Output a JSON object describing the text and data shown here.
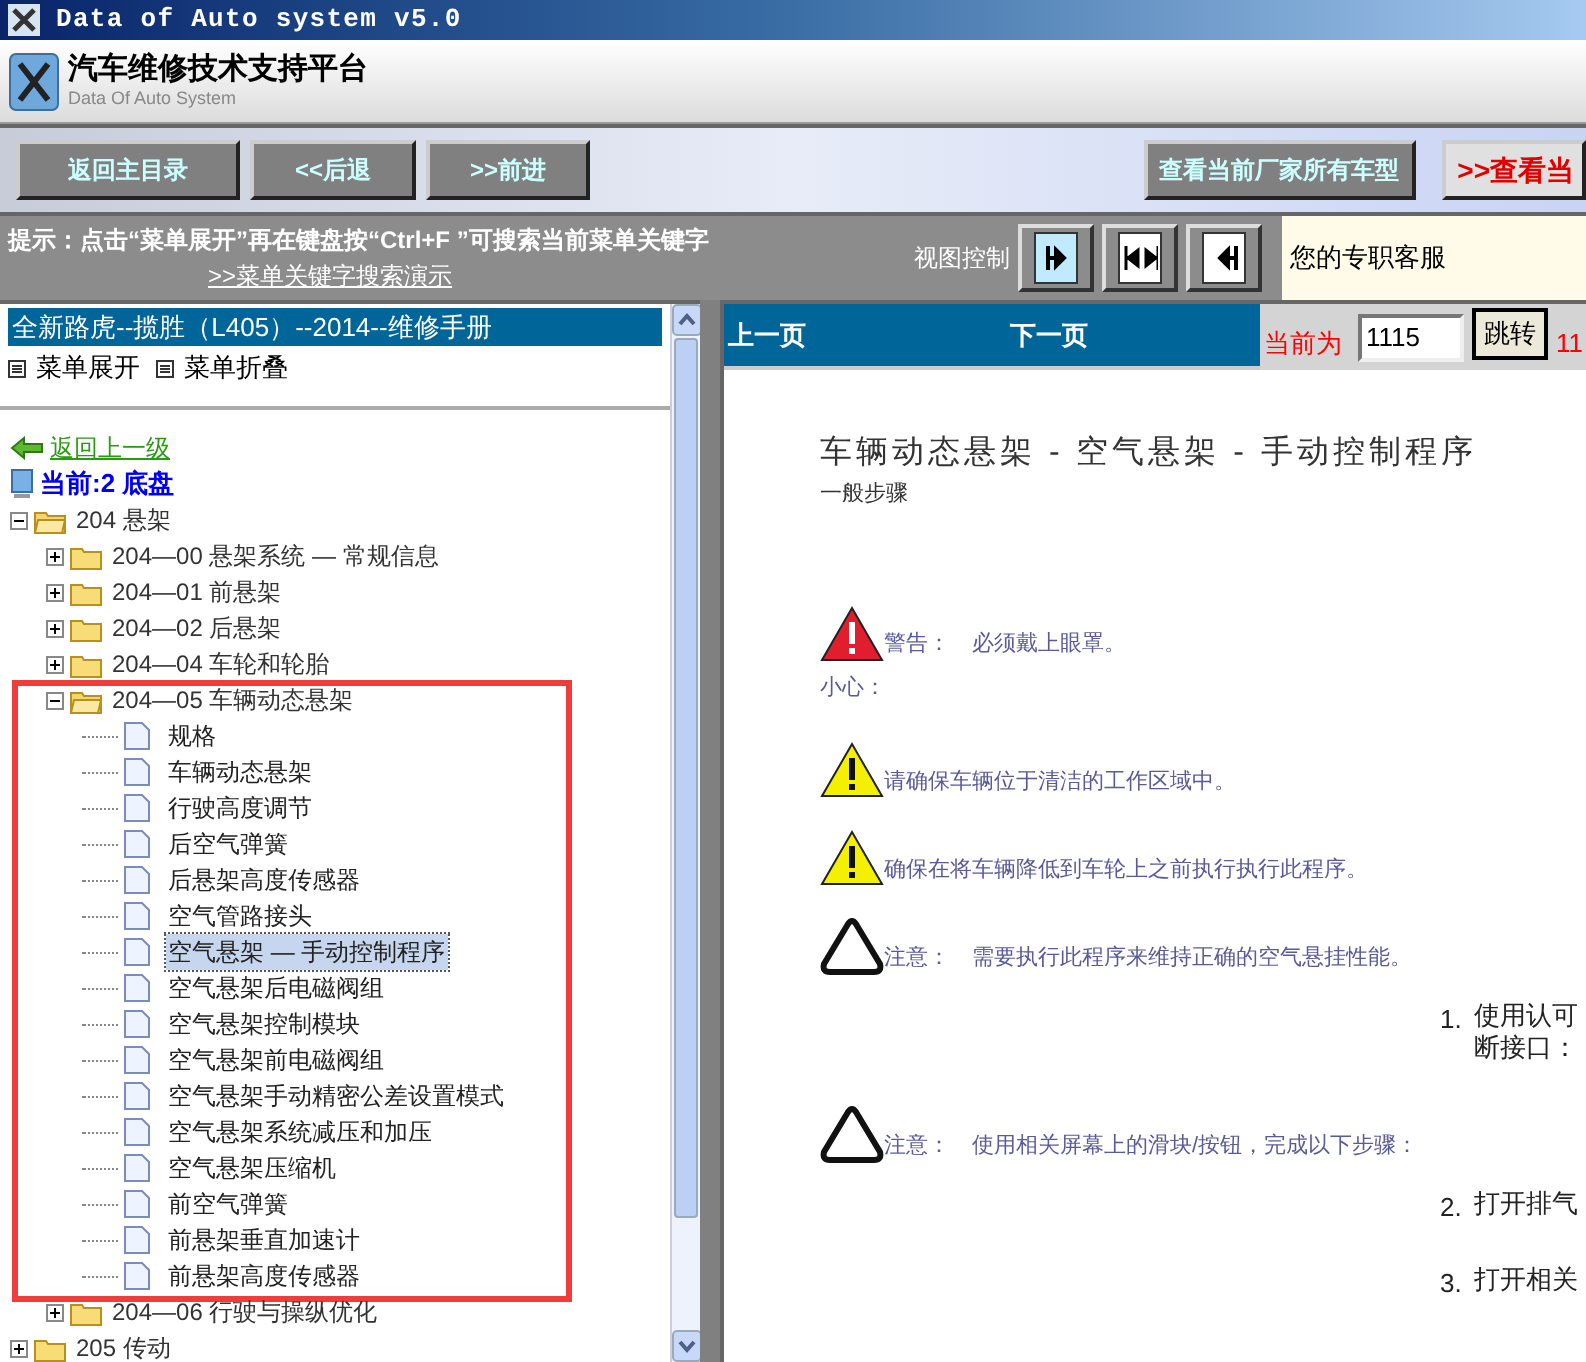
{
  "window": {
    "title": "Data of Auto system v5.0"
  },
  "header": {
    "title": "汽车维修技术支持平台",
    "subtitle": "Data Of Auto System"
  },
  "toolbar": {
    "buttons": [
      {
        "label": "返回主目录",
        "kind": "nav"
      },
      {
        "label": "<<后退",
        "kind": "nav"
      },
      {
        "label": ">>前进",
        "kind": "nav"
      },
      {
        "label": "查看当前厂家所有车型",
        "kind": "wide"
      },
      {
        "label": ">>查看当",
        "kind": "alert"
      }
    ]
  },
  "hint": {
    "text": "提示：点击“菜单展开”再在键盘按“Ctrl+F ”可搜索当前菜单关键字",
    "link": ">>菜单关键字搜索演示",
    "view_label": "视图控制",
    "service": "您的专职客服"
  },
  "left": {
    "manual_title": "全新路虎--揽胜（L405）--2014--维修手册",
    "menu_actions": [
      "菜单展开",
      "菜单折叠"
    ],
    "back_link": "返回上一级",
    "current": "当前:2 底盘",
    "tree": [
      {
        "label": "204 悬架",
        "kind": "folder",
        "expanded": true,
        "children": [
          {
            "label": "204—00 悬架系统 — 常规信息",
            "kind": "folder",
            "expanded": false
          },
          {
            "label": "204—01 前悬架",
            "kind": "folder",
            "expanded": false
          },
          {
            "label": "204—02 后悬架",
            "kind": "folder",
            "expanded": false
          },
          {
            "label": "204—04 车轮和轮胎",
            "kind": "folder",
            "expanded": false
          },
          {
            "label": "204—05 车辆动态悬架",
            "kind": "folder",
            "expanded": true,
            "highlighted": true,
            "children": [
              {
                "label": "规格",
                "kind": "page",
                "selected": false
              },
              {
                "label": "车辆动态悬架",
                "kind": "page",
                "selected": false
              },
              {
                "label": "行驶高度调节",
                "kind": "page",
                "selected": false
              },
              {
                "label": "后空气弹簧",
                "kind": "page",
                "selected": false
              },
              {
                "label": "后悬架高度传感器",
                "kind": "page",
                "selected": false
              },
              {
                "label": "空气管路接头",
                "kind": "page",
                "selected": false
              },
              {
                "label": "空气悬架 — 手动控制程序",
                "kind": "page",
                "selected": true
              },
              {
                "label": "空气悬架后电磁阀组",
                "kind": "page",
                "selected": false
              },
              {
                "label": "空气悬架控制模块",
                "kind": "page",
                "selected": false
              },
              {
                "label": "空气悬架前电磁阀组",
                "kind": "page",
                "selected": false
              },
              {
                "label": "空气悬架手动精密公差设置模式",
                "kind": "page",
                "selected": false
              },
              {
                "label": "空气悬架系统减压和加压",
                "kind": "page",
                "selected": false
              },
              {
                "label": "空气悬架压缩机",
                "kind": "page",
                "selected": false
              },
              {
                "label": "前空气弹簧",
                "kind": "page",
                "selected": false
              },
              {
                "label": "前悬架垂直加速计",
                "kind": "page",
                "selected": false
              },
              {
                "label": "前悬架高度传感器",
                "kind": "page",
                "selected": false
              }
            ]
          },
          {
            "label": "204—06 行驶与操纵优化",
            "kind": "folder",
            "expanded": false
          }
        ]
      },
      {
        "label": "205 传动",
        "kind": "folder",
        "expanded": false
      }
    ]
  },
  "right": {
    "nav": {
      "prev": "上一页",
      "next": "下一页",
      "current_label": "当前为",
      "page_value": "1115",
      "jump_button": "跳转",
      "total": "11"
    },
    "doc": {
      "title": "车辆动态悬架 - 空气悬架 - 手动控制程序",
      "subtitle": "一般步骤",
      "blocks": [
        {
          "kind": "warning",
          "text": "警告：　必须戴上眼罩。"
        },
        {
          "kind": "label",
          "text": "小心："
        },
        {
          "kind": "caution",
          "text": "请确保车辆位于清洁的工作区域中。"
        },
        {
          "kind": "caution",
          "text": "确保在将车辆降低到车轮上之前执行执行此程序。"
        },
        {
          "kind": "notice",
          "text": "注意：　需要执行此程序来维持正确的空气悬挂性能。"
        },
        {
          "kind": "step",
          "number": "1.",
          "lines": [
            "使用认可",
            "断接口："
          ]
        },
        {
          "kind": "notice",
          "text": "注意：　使用相关屏幕上的滑块/按钮，完成以下步骤："
        },
        {
          "kind": "step",
          "number": "2.",
          "lines": [
            "打开排气"
          ]
        },
        {
          "kind": "step",
          "number": "3.",
          "lines": [
            "打开相关"
          ]
        }
      ]
    }
  }
}
